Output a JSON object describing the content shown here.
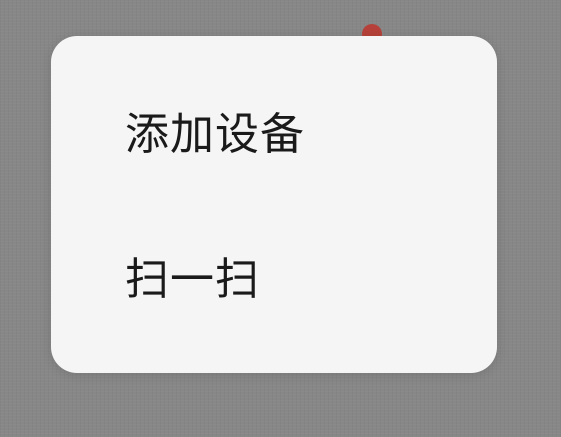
{
  "popup_menu": {
    "items": [
      {
        "label": "添加设备"
      },
      {
        "label": "扫一扫"
      }
    ]
  },
  "notification": {
    "badge_color": "#b5413a"
  },
  "colors": {
    "backdrop": "#878787",
    "menu_background": "#f5f5f5",
    "text": "#1a1a1a"
  }
}
